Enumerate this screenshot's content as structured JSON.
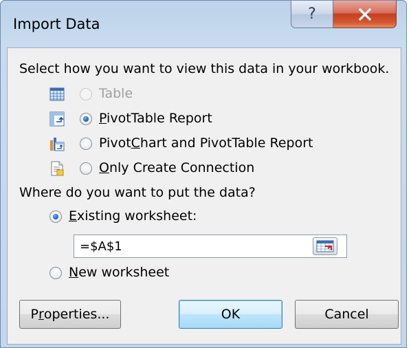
{
  "dialog": {
    "title": "Import Data",
    "help_label": "?",
    "close_label": "X"
  },
  "view_section": {
    "prompt": "Select how you want to view this data in your workbook.",
    "options": [
      {
        "label": "Table",
        "state": "disabled",
        "icon": "table-icon"
      },
      {
        "mn": "P",
        "rest": "ivotTable Report",
        "state": "selected",
        "icon": "pivottable-icon"
      },
      {
        "pre": "Pivot",
        "mn": "C",
        "rest": "hart and PivotTable Report",
        "state": "unselected",
        "icon": "pivotchart-icon"
      },
      {
        "mn": "O",
        "rest": "nly Create Connection",
        "state": "unselected",
        "icon": "connection-icon"
      }
    ]
  },
  "location_section": {
    "prompt": "Where do you want to put the data?",
    "existing": {
      "mn": "E",
      "rest": "xisting worksheet:",
      "state": "selected"
    },
    "reference_value": "=$A$1",
    "new_sheet": {
      "mn": "N",
      "rest": "ew worksheet",
      "state": "unselected"
    }
  },
  "buttons": {
    "properties": {
      "pre": "P",
      "mn": "r",
      "rest": "operties..."
    },
    "ok": "OK",
    "cancel": "Cancel"
  },
  "colors": {
    "title_bar": "#c3d6ec",
    "close_button": "#c4401f",
    "radio_selected": "#1b64c8",
    "default_button_border": "#3c7fb1"
  }
}
